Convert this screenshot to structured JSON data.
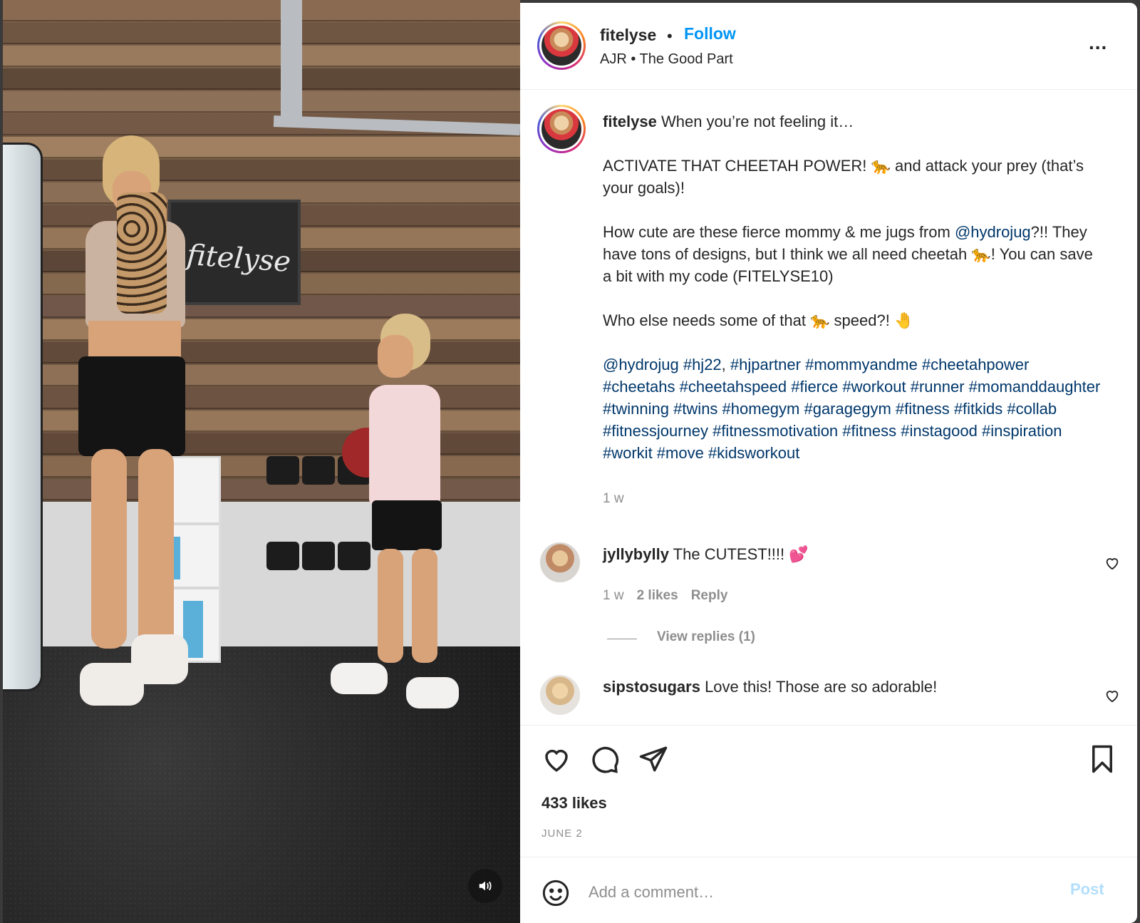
{
  "header": {
    "username": "fitelyse",
    "dot": "•",
    "follow_label": "Follow",
    "audio": "AJR • The Good Part",
    "more": "..."
  },
  "caption": {
    "username": "fitelyse",
    "line1": "When you’re not feeling it…",
    "p2a": "ACTIVATE THAT CHEETAH POWER! 🐆 and attack your prey (that’s your goals)!",
    "p3a": "How cute are these fierce mommy & me jugs from ",
    "p3_mention": "@hydrojug",
    "p3b": "?!! They have tons of designs, but I think we all need cheetah 🐆! You can save a bit with my code (FITELYSE10)",
    "p4": "Who else needs some of that 🐆 speed?! 🤚",
    "tags_a": "@hydrojug #hj22",
    "tags_comma": ", ",
    "tags_b": "#hjpartner #mommyandme #cheetahpower #cheetahs #cheetahspeed #fierce #workout #runner #momanddaughter #twinning #twins #homegym #garagegym #fitness #fitkids #collab #fitnessjourney #fitnessmotivation #fitness #instagood #inspiration #workit #move #kidsworkout",
    "time": "1 w"
  },
  "comments": [
    {
      "username": "jyllybylly",
      "text": "The CUTEST!!!! 💕",
      "time": "1 w",
      "likes": "2 likes",
      "reply": "Reply",
      "view_replies": "View replies (1)"
    },
    {
      "username": "sipstosugars",
      "text": "Love this! Those are so adorable!"
    }
  ],
  "post": {
    "likes": "433 likes",
    "date": "JUNE 2"
  },
  "composer": {
    "placeholder": "Add a comment…",
    "post_label": "Post"
  },
  "media": {
    "chalk_text": "fitelyse"
  },
  "colors": {
    "accent": "#0095f6",
    "link": "#00376b",
    "muted": "#8e8e8e",
    "post_disabled": "#b2dffc"
  }
}
